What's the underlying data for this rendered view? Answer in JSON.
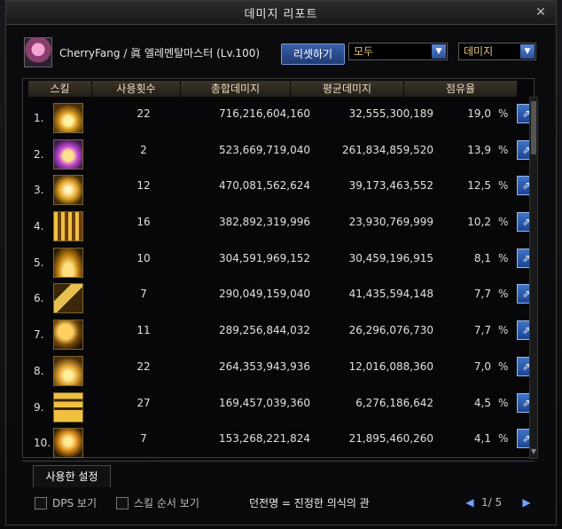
{
  "window": {
    "title": "데미지 리포트"
  },
  "character": {
    "info": "CherryFang / 眞 엘레멘탈마스터 (Lv.100)"
  },
  "toolbar": {
    "reset_label": "리셋하기",
    "filter_value": "모두",
    "sort_value": "데미지"
  },
  "table": {
    "headers": [
      "스킬",
      "사용횟수",
      "총합데미지",
      "평균데미지",
      "점유율"
    ],
    "rows": [
      {
        "rank": "1.",
        "icon": "skill-icon-1",
        "uses": "22",
        "total": "716,216,604,160",
        "avg": "32,555,300,189",
        "share": "19,0",
        "pct": "%"
      },
      {
        "rank": "2.",
        "icon": "skill-icon-2",
        "uses": "2",
        "total": "523,669,719,040",
        "avg": "261,834,859,520",
        "share": "13,9",
        "pct": "%"
      },
      {
        "rank": "3.",
        "icon": "skill-icon-3",
        "uses": "12",
        "total": "470,081,562,624",
        "avg": "39,173,463,552",
        "share": "12,5",
        "pct": "%"
      },
      {
        "rank": "4.",
        "icon": "skill-icon-4",
        "uses": "16",
        "total": "382,892,319,996",
        "avg": "23,930,769,999",
        "share": "10,2",
        "pct": "%"
      },
      {
        "rank": "5.",
        "icon": "skill-icon-5",
        "uses": "10",
        "total": "304,591,969,152",
        "avg": "30,459,196,915",
        "share": "8,1",
        "pct": "%"
      },
      {
        "rank": "6.",
        "icon": "skill-icon-6",
        "uses": "7",
        "total": "290,049,159,040",
        "avg": "41,435,594,148",
        "share": "7,7",
        "pct": "%"
      },
      {
        "rank": "7.",
        "icon": "skill-icon-7",
        "uses": "11",
        "total": "289,256,844,032",
        "avg": "26,296,076,730",
        "share": "7,7",
        "pct": "%"
      },
      {
        "rank": "8.",
        "icon": "skill-icon-8",
        "uses": "22",
        "total": "264,353,943,936",
        "avg": "12,016,088,360",
        "share": "7,0",
        "pct": "%"
      },
      {
        "rank": "9.",
        "icon": "skill-icon-9",
        "uses": "27",
        "total": "169,457,039,360",
        "avg": "6,276,186,642",
        "share": "4,5",
        "pct": "%"
      },
      {
        "rank": "10.",
        "icon": "skill-icon-10",
        "uses": "7",
        "total": "153,268,221,824",
        "avg": "21,895,460,260",
        "share": "4,1",
        "pct": "%"
      }
    ]
  },
  "tabs": {
    "used_settings": "사용한 설정"
  },
  "footer": {
    "dps_label": "DPS 보기",
    "skill_order_label": "스킬 순서 보기",
    "title_text": "던전명 = 진정한 의식의 관",
    "page_indicator": "1/ 5"
  },
  "icons": {
    "close": "close-icon",
    "share": "share-icon",
    "dropdown": "chevron-down-icon",
    "prev": "prev-page-icon",
    "next": "next-page-icon"
  },
  "colors": {
    "accent_blue": "#2d4f99",
    "header_text": "#e8dcc0",
    "dropdown_text": "#e6c27a"
  }
}
